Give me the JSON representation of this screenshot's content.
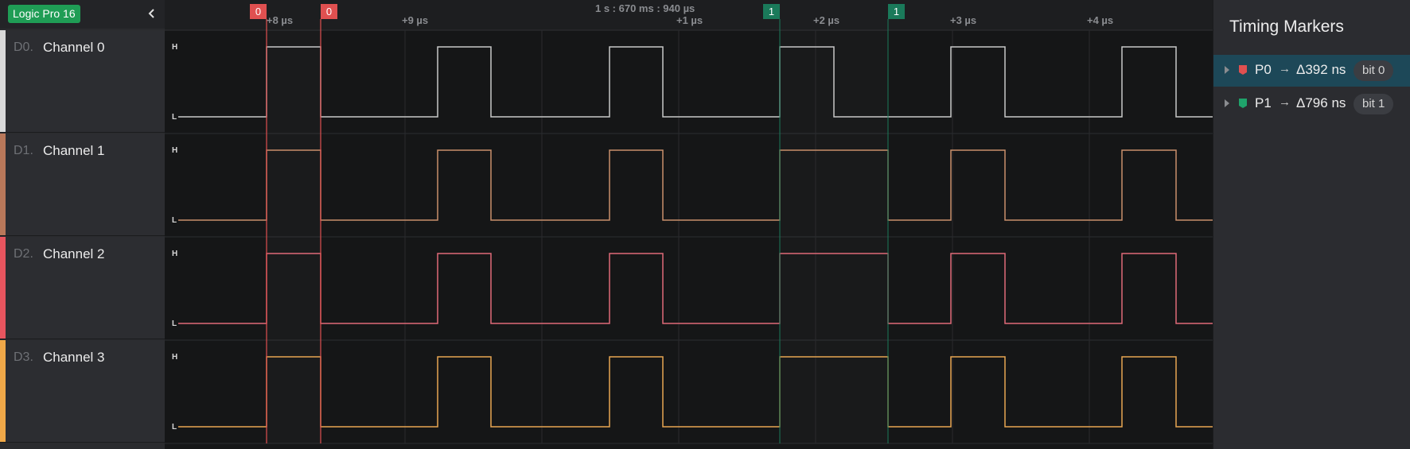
{
  "device": {
    "label": "Logic Pro 16"
  },
  "timeline": {
    "cursor_label": "1 s : 670 ms : 940 µs",
    "ticks": [
      "+8 µs",
      "+9 µs",
      "+1 µs",
      "+2 µs",
      "+3 µs",
      "+4 µs"
    ]
  },
  "channels": [
    {
      "id": "D0.",
      "name": "Channel 0",
      "color": "#c8c8c8",
      "strip": "#d9d9d9",
      "high_label": "H",
      "low_label": "L"
    },
    {
      "id": "D1.",
      "name": "Channel 1",
      "color": "#c98f6b",
      "strip": "#b9785a",
      "high_label": "H",
      "low_label": "L"
    },
    {
      "id": "D2.",
      "name": "Channel 2",
      "color": "#e06a78",
      "strip": "#e8555f",
      "high_label": "H",
      "low_label": "L"
    },
    {
      "id": "D3.",
      "name": "Channel 3",
      "color": "#e8a652",
      "strip": "#f0a848",
      "high_label": "H",
      "low_label": "L"
    }
  ],
  "markers": [
    {
      "flag_label": "0",
      "color": "#e05050"
    },
    {
      "flag_label": "0",
      "color": "#e05050"
    },
    {
      "flag_label": "1",
      "color": "#1a7a5a"
    },
    {
      "flag_label": "1",
      "color": "#1a7a5a"
    }
  ],
  "right_panel": {
    "title": "Timing Markers",
    "items": [
      {
        "name": "P0",
        "arrow": "→",
        "delta": "Δ392 ns",
        "chip": "bit 0",
        "color": "#e05050",
        "selected": true
      },
      {
        "name": "P1",
        "arrow": "→",
        "delta": "Δ796 ns",
        "chip": "bit 1",
        "color": "#1fa36b",
        "selected": false
      }
    ]
  }
}
